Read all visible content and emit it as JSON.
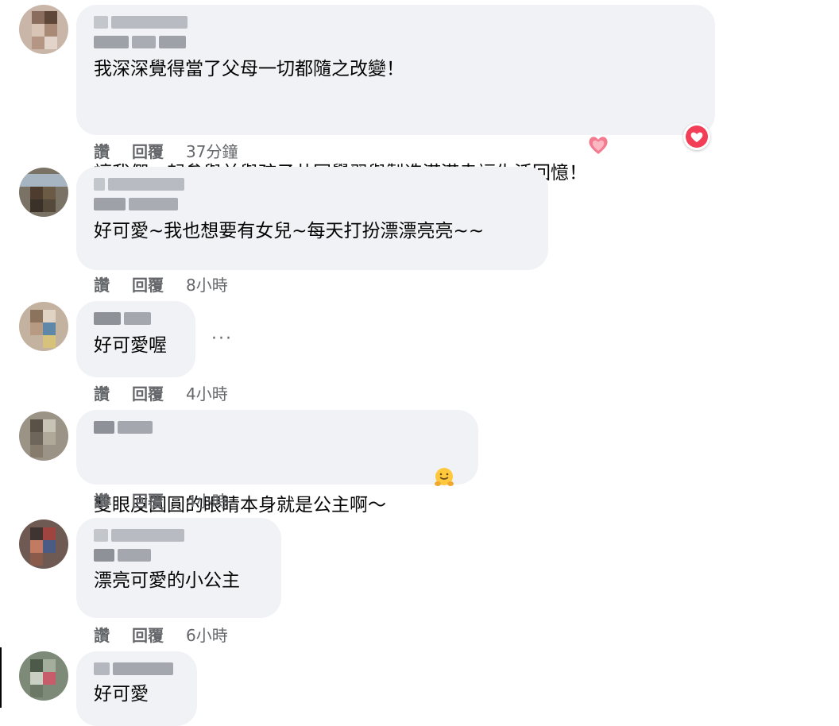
{
  "actions": {
    "like": "讚",
    "reply": "回覆"
  },
  "comments": [
    {
      "text": "我深深覺得當了父母一切都隨之改變！\n讓我們一起參與並與孩子共同學習與製造滿滿幸福生活回憶！",
      "inline_emoji": "heart-emoji",
      "reaction": "love-reaction",
      "time": "37分鐘"
    },
    {
      "text": "好可愛~我也想要有女兒~每天打扮漂漂亮亮~~",
      "time": "8小時"
    },
    {
      "text": "好可愛喔",
      "time": "4小時",
      "more_label": "···"
    },
    {
      "text": "雙眼皮圓圓的眼睛本身就是公主啊～",
      "inline_emoji": "hugging-face-emoji",
      "time": "4小時"
    },
    {
      "text": "漂亮可愛的小公主",
      "time": "6小時"
    },
    {
      "text": "好可愛"
    }
  ],
  "colors": {
    "bubble_bg": "#f0f2f5",
    "meta_text": "#65676b",
    "love_red": "#f33e58",
    "blurred_name": "#b8bcc2"
  }
}
